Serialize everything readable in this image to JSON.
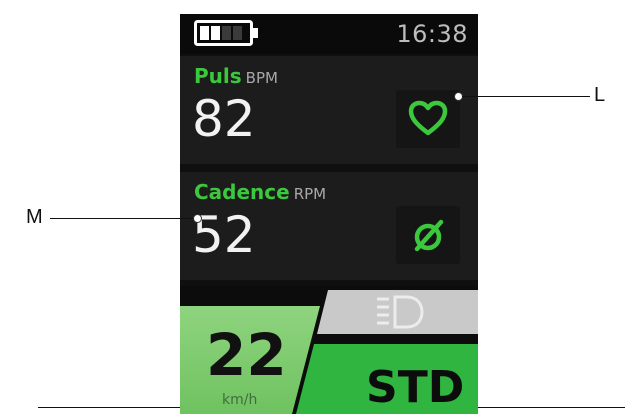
{
  "status": {
    "time": "16:38",
    "battery_level": 0.5
  },
  "puls": {
    "label": "Puls",
    "unit": "BPM",
    "value": "82",
    "icon": "heart-icon"
  },
  "cadence": {
    "label": "Cadence",
    "unit": "RPM",
    "value": "52",
    "icon": "cadence-sensor-icon"
  },
  "speed": {
    "value": "22",
    "unit": "km/h"
  },
  "mode": {
    "label": "STD",
    "light_icon": "headlight-icon"
  },
  "annotations": {
    "right": "L",
    "left": "M"
  },
  "colors": {
    "accent_green": "#3cc83c",
    "speed_green": "#7fcf6f",
    "mode_green": "#2fb540",
    "background": "#0f0f0f"
  }
}
